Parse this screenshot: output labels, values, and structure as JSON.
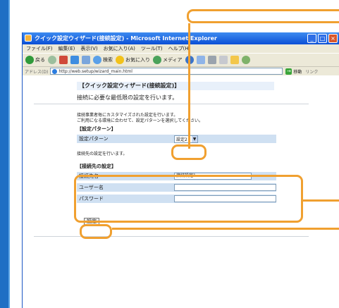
{
  "window": {
    "title": "クイック設定ウィザード(接続設定) - Microsoft Internet Explorer"
  },
  "menu": [
    "ファイル(F)",
    "編集(E)",
    "表示(V)",
    "お気に入り(A)",
    "ツール(T)",
    "ヘルプ(H)"
  ],
  "toolbar": {
    "back": "戻る",
    "search": "検索",
    "favorites": "お気に入り",
    "media": "メディア"
  },
  "address": {
    "label": "アドレス(D)",
    "url": "http://web.setup/wizard_main.html",
    "go": "移動",
    "links": "リンク"
  },
  "page": {
    "banner": "【クイック設定ウィザード(接続設定)】",
    "description": "接続に必要な最低限の設定を行います。",
    "pattern_intro_1": "接続事業者毎にカスタマイズされた設定を行います。",
    "pattern_intro_2": "ご利用になる環境に合わせて、設定パターンを選択してください。",
    "pattern_heading": "【設定パターン】",
    "pattern_label": "設定パターン",
    "pattern_value": "設定2",
    "conn_intro_1": "接続先の設定を行います。",
    "conn_heading": "【接続先の設定】",
    "fields": [
      {
        "label": "接続先名",
        "value": "接続設定1"
      },
      {
        "label": "ユーザー名",
        "value": ""
      },
      {
        "label": "パスワード",
        "value": ""
      }
    ],
    "set_button": "設定"
  },
  "colors": {
    "accent": "#f0a030",
    "titlebar": "#0a4fd6",
    "rowbg": "#cfe0f2"
  }
}
